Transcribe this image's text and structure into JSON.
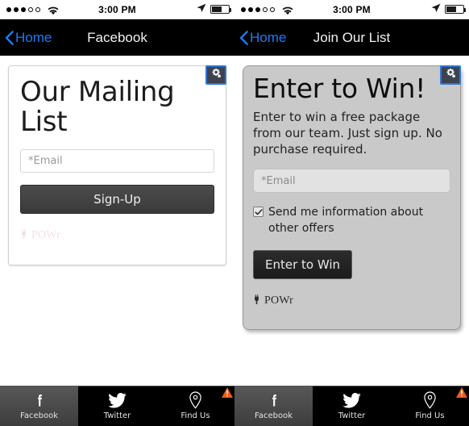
{
  "screens": [
    {
      "statusbar": {
        "signal_filled": 3,
        "signal_empty": 2,
        "wifi_icon": "wifi-icon",
        "time": "3:00 PM",
        "location_icon": "location-arrow-icon",
        "battery_icon": "battery-icon",
        "battery_level": 56
      },
      "navbar": {
        "back_icon": "chevron-left-icon",
        "back_label": "Home",
        "title": "Facebook"
      },
      "card": {
        "style": "white",
        "gear_icon": "gears-icon",
        "title": "Our Mailing List",
        "description": "",
        "email_placeholder": "*Email",
        "email_value": "",
        "submit_label": "Sign-Up",
        "checkbox": null,
        "powr_label": "POWr",
        "powr_icon": "plug-icon",
        "powr_faded": true
      },
      "tabbar": {
        "items": [
          {
            "label": "Facebook",
            "icon": "facebook-icon",
            "active": true
          },
          {
            "label": "Twitter",
            "icon": "twitter-icon",
            "active": false
          },
          {
            "label": "Find Us",
            "icon": "map-pin-icon",
            "active": false
          }
        ],
        "badge_icon": "warning-triangle-icon"
      }
    },
    {
      "statusbar": {
        "signal_filled": 3,
        "signal_empty": 2,
        "wifi_icon": "wifi-icon",
        "time": "3:00 PM",
        "location_icon": "location-arrow-icon",
        "battery_icon": "battery-icon",
        "battery_level": 56
      },
      "navbar": {
        "back_icon": "chevron-left-icon",
        "back_label": "Home",
        "title": "Join Our List"
      },
      "card": {
        "style": "gray",
        "gear_icon": "gears-icon",
        "title": "Enter to Win!",
        "description": "Enter to win a free package from our team. Just sign up. No purchase required.",
        "email_placeholder": "*Email",
        "email_value": "",
        "submit_label": "Enter to Win",
        "checkbox": {
          "label": "Send me information about other offers",
          "checked": true
        },
        "powr_label": "POWr",
        "powr_icon": "plug-icon",
        "powr_faded": false
      },
      "tabbar": {
        "items": [
          {
            "label": "Facebook",
            "icon": "facebook-icon",
            "active": true
          },
          {
            "label": "Twitter",
            "icon": "twitter-icon",
            "active": false
          },
          {
            "label": "Find Us",
            "icon": "map-pin-icon",
            "active": false
          }
        ],
        "badge_icon": "warning-triangle-icon"
      }
    }
  ],
  "colors": {
    "navbar_bg": "#000000",
    "back_link": "#1d7bf5",
    "card_gray_bg": "#c9c9c9",
    "gear_border": "#2f77d6",
    "badge_orange": "#e85d1a"
  }
}
